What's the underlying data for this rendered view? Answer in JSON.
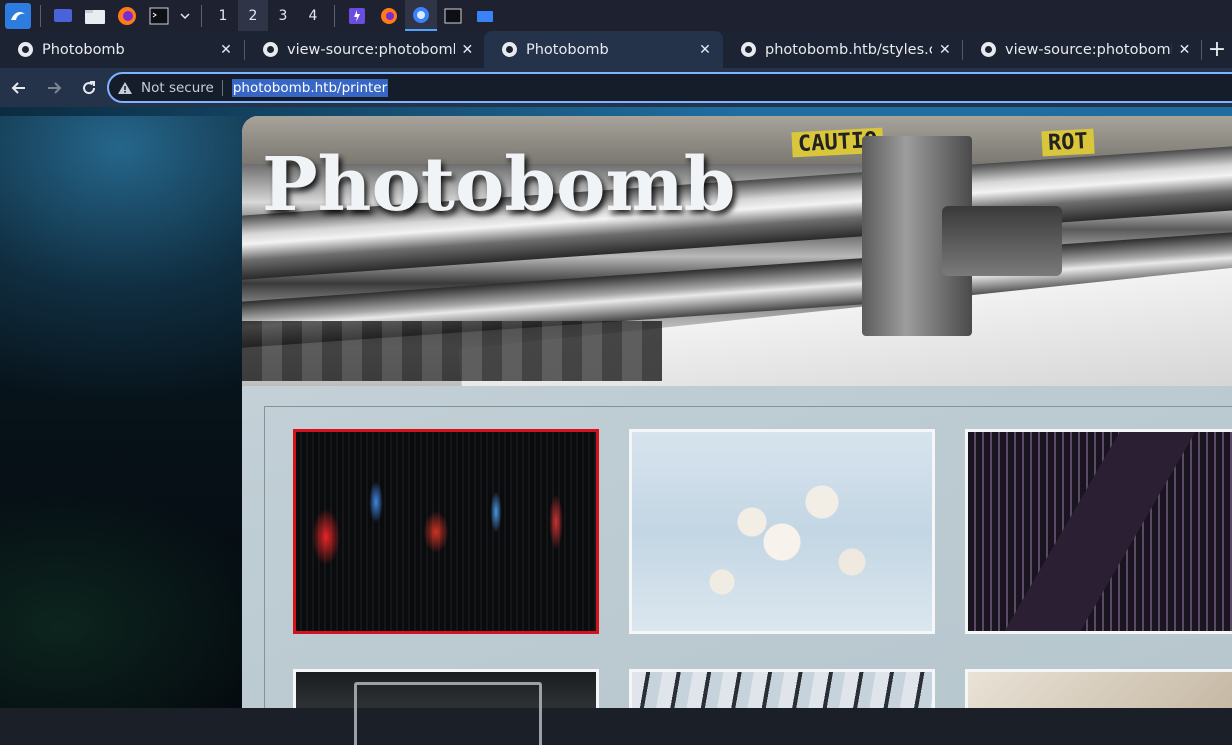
{
  "taskbar": {
    "workspaces": [
      "1",
      "2",
      "3",
      "4"
    ],
    "active_workspace": "2"
  },
  "tabs": [
    {
      "title": "Photobomb",
      "active": false
    },
    {
      "title": "view-source:photobomb.htb",
      "active": false
    },
    {
      "title": "Photobomb",
      "active": true
    },
    {
      "title": "photobomb.htb/styles.css",
      "active": false
    },
    {
      "title": "view-source:photobomb.htb",
      "active": false
    }
  ],
  "toolbar": {
    "security_label": "Not secure",
    "url": "photobomb.htb/printer"
  },
  "page": {
    "title": "Photobomb",
    "banner_signs": [
      "CAUTIO",
      "ROT"
    ],
    "gallery": [
      {
        "selected": true
      },
      {
        "selected": false
      },
      {
        "selected": false
      },
      {
        "selected": false
      },
      {
        "selected": false
      },
      {
        "selected": false
      }
    ]
  },
  "colors": {
    "accent": "#7fb2ff",
    "url_selection": "#3866c4",
    "selected_thumb_border": "#d3121b"
  }
}
